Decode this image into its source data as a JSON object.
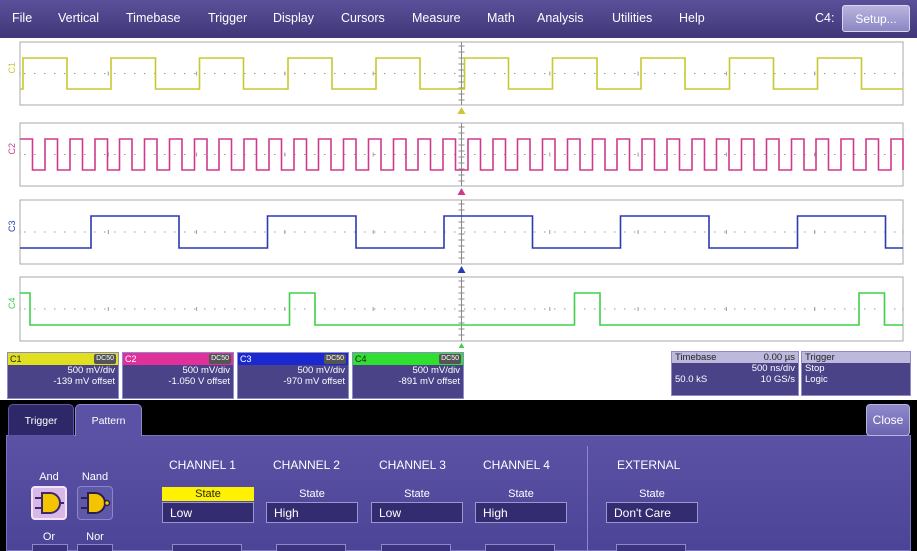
{
  "menu": {
    "items": [
      "File",
      "Vertical",
      "Timebase",
      "Trigger",
      "Display",
      "Cursors",
      "Measure",
      "Math",
      "Analysis",
      "Utilities",
      "Help"
    ],
    "active_channel": "C4:",
    "setup_label": "Setup..."
  },
  "traces": [
    {
      "name": "C1",
      "color": "#c8c832"
    },
    {
      "name": "C2",
      "color": "#d03a8c"
    },
    {
      "name": "C3",
      "color": "#2a3ab0"
    },
    {
      "name": "C4",
      "color": "#3ed04a"
    }
  ],
  "channels": [
    {
      "label": "C1",
      "coupling": "DC50",
      "scale": "500 mV/div",
      "offset": "-139 mV offset",
      "color": "#e0e020",
      "text_color": "#222222"
    },
    {
      "label": "C2",
      "coupling": "DC50",
      "scale": "500 mV/div",
      "offset": "-1.050 V offset",
      "color": "#e0309a",
      "text_color": "#ffffff"
    },
    {
      "label": "C3",
      "coupling": "DC50",
      "scale": "500 mV/div",
      "offset": "-970 mV offset",
      "color": "#1a28d0",
      "text_color": "#ffffff"
    },
    {
      "label": "C4",
      "coupling": "DC50",
      "scale": "500 mV/div",
      "offset": "-891 mV offset",
      "color": "#30e030",
      "text_color": "#222222"
    }
  ],
  "timebase": {
    "label": "Timebase",
    "delay": "0.00 µs",
    "per_div": "500 ns/div",
    "samples": "50.0 kS",
    "rate": "10 GS/s"
  },
  "trigger": {
    "label": "Trigger",
    "mode": "Stop",
    "type": "Logic"
  },
  "dialog": {
    "tabs": [
      "Trigger",
      "Pattern"
    ],
    "close_label": "Close",
    "gates": {
      "and": "And",
      "nand": "Nand",
      "or": "Or",
      "nor": "Nor"
    },
    "columns": [
      {
        "header": "CHANNEL 1",
        "state_label": "State",
        "value": "Low"
      },
      {
        "header": "CHANNEL 2",
        "state_label": "State",
        "value": "High"
      },
      {
        "header": "CHANNEL 3",
        "state_label": "State",
        "value": "Low"
      },
      {
        "header": "CHANNEL 4",
        "state_label": "State",
        "value": "High"
      },
      {
        "header": "EXTERNAL",
        "state_label": "State",
        "value": "Don't Care"
      }
    ]
  }
}
